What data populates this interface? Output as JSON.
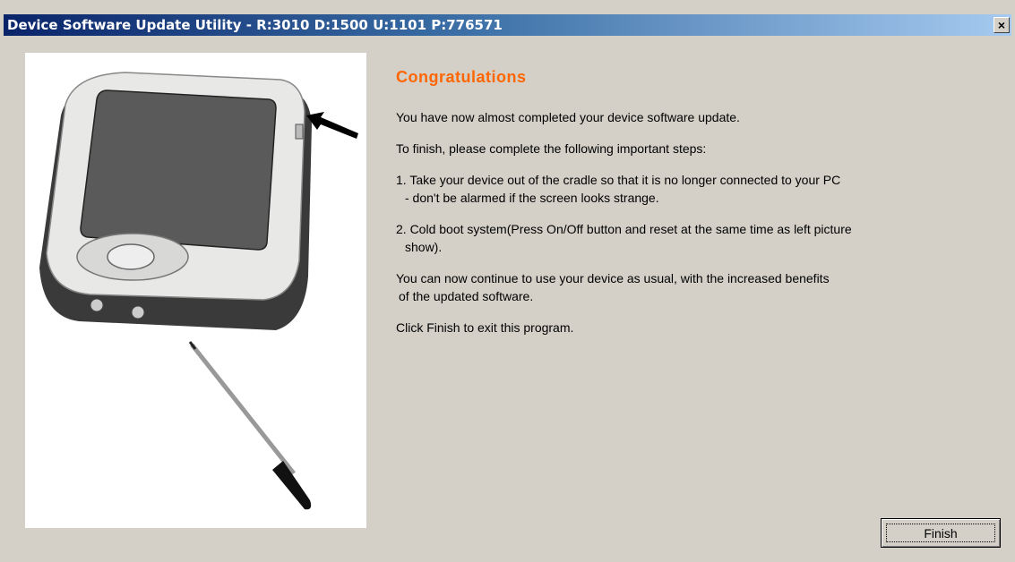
{
  "window": {
    "title": "Device Software Update Utility - R:3010 D:1500 U:1101 P:776571",
    "close_label": "×"
  },
  "content": {
    "heading": "Congratulations",
    "intro": "You have now almost completed your device software update.",
    "finish_prompt": "To finish, please complete the following important steps:",
    "step1_line1": "1. Take your device out of the cradle so that it is no longer connected to your PC",
    "step1_line2": "- don't be alarmed if the screen looks strange.",
    "step2_line1": "2. Cold boot system(Press On/Off button and reset at the same time as left picture",
    "step2_line2": "show).",
    "continue_line1": "You can now continue to use your device as usual, with the increased benefits",
    "continue_line2": "of the updated software.",
    "exit_note": "Click Finish to exit this program."
  },
  "buttons": {
    "finish_label": "Finish"
  },
  "colors": {
    "heading": "#ff6600",
    "title_bar_start": "#0a246a",
    "title_bar_end": "#a6caf0",
    "dialog_background": "#d4d0c8"
  }
}
